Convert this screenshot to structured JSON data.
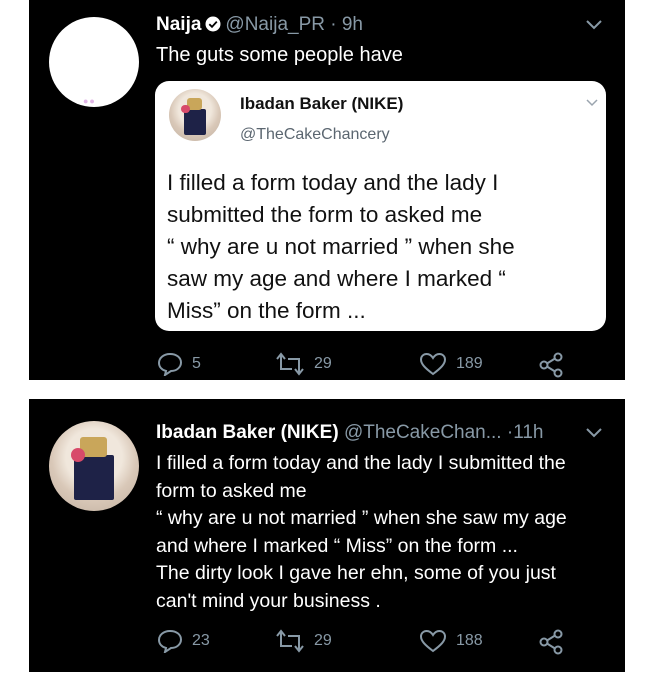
{
  "tweet1": {
    "author_name": "Naija",
    "handle": "@Naija_PR",
    "separator": "·",
    "time": "9h",
    "text": "The guts some people have",
    "quoted": {
      "author_name": "Ibadan Baker (NIKE)",
      "handle": "@TheCakeChancery",
      "lines": [
        "I filled a form today and the lady I",
        "submitted the form to asked me",
        "“ why are u not married ” when she",
        "saw my age and where I marked “",
        "Miss” on the form ..."
      ]
    },
    "replies": "5",
    "retweets": "29",
    "likes": "189"
  },
  "tweet2": {
    "author_name": "Ibadan Baker (NIKE)",
    "handle": "@TheCakeChan...",
    "separator": "·",
    "time": "11h",
    "lines": [
      "I filled a form today and the lady I submitted the",
      "form to asked me",
      "“ why are u not married ” when she saw my age",
      "and where I marked “ Miss” on the form ...",
      "The dirty look I gave her ehn, some of you just",
      "can't mind your business ."
    ],
    "replies": "23",
    "retweets": "29",
    "likes": "188"
  },
  "colors": {
    "background": "#000000",
    "muted": "#8899a6",
    "quote_bg": "#ffffff"
  },
  "icons": [
    "verified-icon",
    "chevron-down-icon",
    "reply-icon",
    "retweet-icon",
    "like-icon",
    "share-icon"
  ]
}
